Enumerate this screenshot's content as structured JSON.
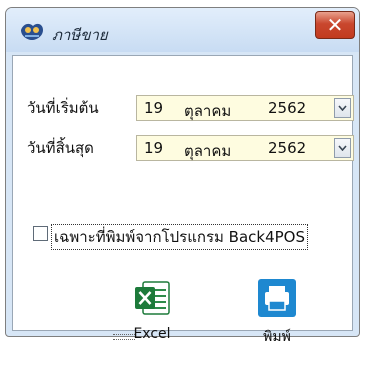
{
  "window": {
    "title": "ภาษีขาย",
    "close_glyph": "✕"
  },
  "form": {
    "start_label": "วันที่เริ่มต้น",
    "end_label": "วันที่สิ้นสุด",
    "start_date": {
      "day": "19",
      "month": "ตุลาคม",
      "year": "2562"
    },
    "end_date": {
      "day": "19",
      "month": "ตุลาคม",
      "year": "2562"
    },
    "filter_checkbox": {
      "label": "เฉพาะที่พิมพ์จากโปรแกรม Back4POS",
      "checked": false
    }
  },
  "actions": {
    "excel_label": "Excel",
    "print_label": "พิมพ์"
  },
  "colors": {
    "excel_green": "#1d7a3a",
    "print_blue": "#1e88d0",
    "close_red": "#c9472e",
    "date_bg": "#fefce0"
  }
}
